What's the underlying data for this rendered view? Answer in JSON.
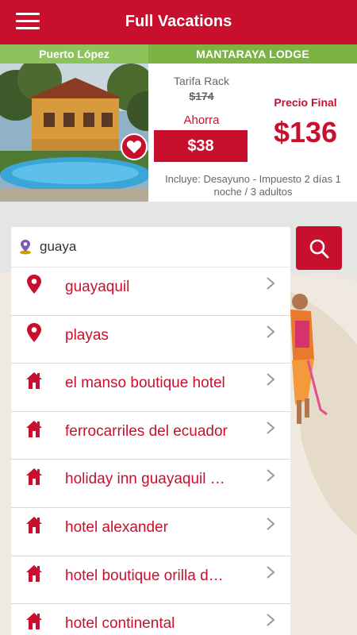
{
  "header": {
    "title": "Full Vacations",
    "menu_icon": "hamburger-menu-icon"
  },
  "promo": {
    "location": "Puerto López",
    "hotel_name": "MANTARAYA LODGE",
    "rack_label": "Tarifa Rack",
    "rack_price": "$174",
    "save_label": "Ahorra",
    "save_amount": "$38",
    "final_label": "Precio Final",
    "final_price": "$136",
    "includes": "Incluye: Desayuno - Impuesto 2 días 1 noche / 3 adultos",
    "favorite_icon": "heart-icon"
  },
  "search": {
    "value": "guaya",
    "placeholder": "",
    "icon": "location-pin-icon",
    "button_icon": "search-icon"
  },
  "suggestions": [
    {
      "label": "guayaquil",
      "icon": "map-pin-icon"
    },
    {
      "label": "playas",
      "icon": "map-pin-icon"
    },
    {
      "label": "el manso boutique hotel",
      "icon": "house-icon"
    },
    {
      "label": "ferrocarriles del ecuador",
      "icon": "house-icon"
    },
    {
      "label": "holiday inn guayaquil …",
      "icon": "house-icon"
    },
    {
      "label": "hotel alexander",
      "icon": "house-icon"
    },
    {
      "label": "hotel boutique orilla d…",
      "icon": "house-icon"
    },
    {
      "label": "hotel continental",
      "icon": "house-icon"
    }
  ],
  "colors": {
    "brand": "#c8102e",
    "green": "#7cb342",
    "green_light": "#8cc35a"
  }
}
